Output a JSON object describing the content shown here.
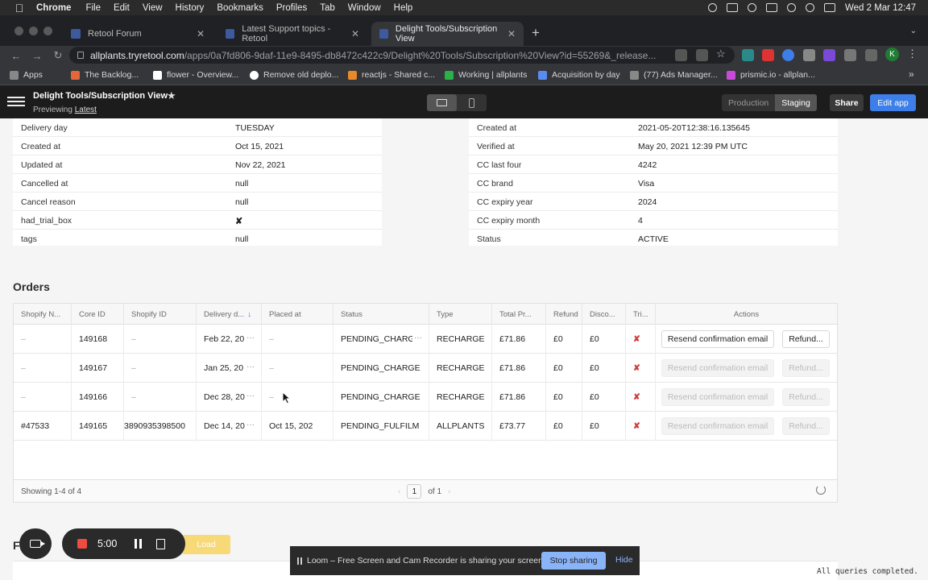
{
  "menubar": {
    "app": "Chrome",
    "items": [
      "File",
      "Edit",
      "View",
      "History",
      "Bookmarks",
      "Profiles",
      "Tab",
      "Window",
      "Help"
    ],
    "clock": "Wed 2 Mar  12:47"
  },
  "tabs": [
    {
      "title": "Retool Forum",
      "color": "#3d5a9e"
    },
    {
      "title": "Latest Support topics - Retool",
      "color": "#3d5a9e"
    },
    {
      "title": "Delight Tools/Subscription View",
      "color": "#3d5a9e"
    }
  ],
  "address": {
    "host": "allplants.tryretool.com",
    "path": "/apps/0a7fd806-9daf-11e9-8495-db8472c422c9/Delight%20Tools/Subscription%20View?id=55269&_release..."
  },
  "bookmarks": [
    "Apps",
    "The Backlog...",
    "flower - Overview...",
    "Remove old deplo...",
    "reactjs - Shared c...",
    "Working | allplants",
    "Acquisition by day",
    "(77) Ads Manager...",
    "prismic.io - allplan..."
  ],
  "header": {
    "title": "Delight Tools/Subscription View",
    "previewing": "Previewing",
    "version": "Latest",
    "env_production": "Production",
    "env_staging": "Staging",
    "share": "Share",
    "edit": "Edit app"
  },
  "left_details": [
    {
      "k": "Delivery day",
      "v": "TUESDAY"
    },
    {
      "k": "Created at",
      "v": "Oct 15, 2021"
    },
    {
      "k": "Updated at",
      "v": "Nov 22, 2021"
    },
    {
      "k": "Cancelled at",
      "v": "null"
    },
    {
      "k": "Cancel reason",
      "v": "null"
    },
    {
      "k": "had_trial_box",
      "v": "✘"
    },
    {
      "k": "tags",
      "v": "null"
    }
  ],
  "right_details": [
    {
      "k": "Created at",
      "v": "2021-05-20T12:38:16.135645"
    },
    {
      "k": "Verified at",
      "v": "May 20, 2021 12:39 PM UTC"
    },
    {
      "k": "CC last four",
      "v": "4242"
    },
    {
      "k": "CC brand",
      "v": "Visa"
    },
    {
      "k": "CC expiry year",
      "v": "2024"
    },
    {
      "k": "CC expiry month",
      "v": "4"
    },
    {
      "k": "Status",
      "v": "ACTIVE"
    }
  ],
  "orders": {
    "title": "Orders",
    "columns": [
      "Shopify N...",
      "Core ID",
      "Shopify ID",
      "Delivery d...",
      "Placed at",
      "Status",
      "Type",
      "Total Pr...",
      "Refund",
      "Disco...",
      "Tri...",
      "Actions"
    ],
    "rows": [
      {
        "shopify_n": "–",
        "core_id": "149168",
        "shopify_id": "–",
        "delivery": "Feb 22, 20",
        "placed": "–",
        "status": "PENDING_CHARGE",
        "type": "RECHARGE",
        "total": "£71.86",
        "refund": "£0",
        "discount": "£0",
        "trial": "✘",
        "enabled": true
      },
      {
        "shopify_n": "–",
        "core_id": "149167",
        "shopify_id": "–",
        "delivery": "Jan 25, 20",
        "placed": "–",
        "status": "PENDING_CHARGE",
        "type": "RECHARGE",
        "total": "£71.86",
        "refund": "£0",
        "discount": "£0",
        "trial": "✘",
        "enabled": false
      },
      {
        "shopify_n": "–",
        "core_id": "149166",
        "shopify_id": "–",
        "delivery": "Dec 28, 20",
        "placed": "–",
        "status": "PENDING_CHARGE",
        "type": "RECHARGE",
        "total": "£71.86",
        "refund": "£0",
        "discount": "£0",
        "trial": "✘",
        "enabled": false
      },
      {
        "shopify_n": "#47533",
        "core_id": "149165",
        "shopify_id": "3890935398500",
        "delivery": "Dec 14, 20",
        "placed": "Oct 15, 202",
        "status": "PENDING_FULFILM",
        "type": "ALLPLANTS",
        "total": "£73.77",
        "refund": "£0",
        "discount": "£0",
        "trial": "✘",
        "enabled": false
      }
    ],
    "resend_label": "Resend confirmation email",
    "refund_label": "Refund...",
    "showing": "Showing 1-4 of 4",
    "page": "1",
    "of_pages": "of 1"
  },
  "load_label": "Load",
  "section_letter": "F",
  "loom": {
    "timer": "5:00",
    "message": "Loom – Free Screen and Cam Recorder is sharing your screen.",
    "stop": "Stop sharing",
    "hide": "Hide"
  },
  "queries_status": "All queries completed."
}
